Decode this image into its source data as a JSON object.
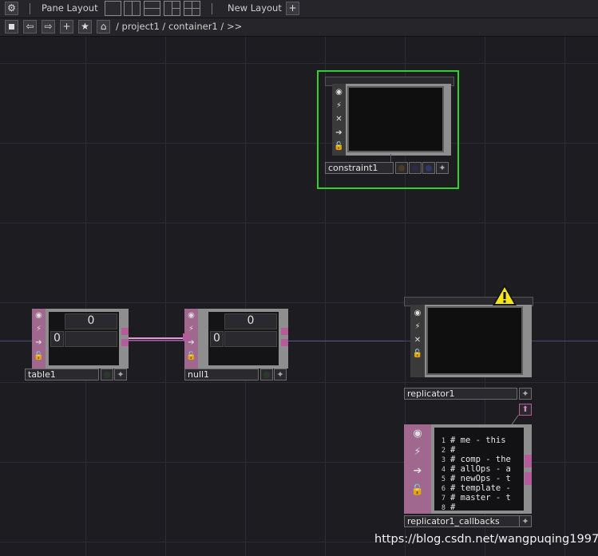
{
  "toolbar": {
    "pane_layout_label": "Pane Layout",
    "new_layout_label": "New Layout",
    "add_symbol": "+"
  },
  "pathbar": {
    "path": "/ project1 / container1 / >>",
    "plus_symbol": "+",
    "star_symbol": "★"
  },
  "nodes": {
    "constraint1": {
      "name": "constraint1",
      "selected_color": "#2fd12f"
    },
    "table1": {
      "name": "table1",
      "cell_header": "0",
      "row_index": "0"
    },
    "null1": {
      "name": "null1",
      "cell_header": "0",
      "row_index": "0"
    },
    "replicator1": {
      "name": "replicator1",
      "warning_icon": "warning-triangle-icon"
    },
    "replicator1_callbacks": {
      "name": "replicator1_callbacks",
      "lines": [
        {
          "n": "1",
          "text": "# me - this"
        },
        {
          "n": "2",
          "text": "#"
        },
        {
          "n": "3",
          "text": "# comp - the"
        },
        {
          "n": "4",
          "text": "# allOps - a"
        },
        {
          "n": "5",
          "text": "# newOps - t"
        },
        {
          "n": "6",
          "text": "# template -"
        },
        {
          "n": "7",
          "text": "# master - t"
        },
        {
          "n": "8",
          "text": "#"
        }
      ]
    }
  },
  "watermark": "https://blog.csdn.net/wangpuqing1997",
  "colors": {
    "wire": "#e59ad2",
    "port": "#b35b9b",
    "accent_pink": "#a0678f"
  }
}
